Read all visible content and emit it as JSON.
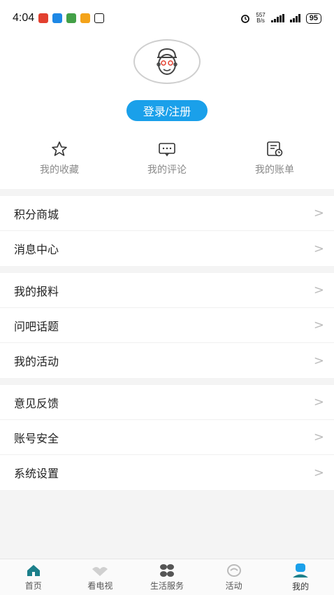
{
  "status_bar": {
    "time": "4:04",
    "net_speed_value": "557",
    "net_speed_unit": "B/s",
    "battery": "95"
  },
  "profile": {
    "login_label": "登录/注册"
  },
  "quick_actions": [
    {
      "label": "我的收藏",
      "icon": "star-icon"
    },
    {
      "label": "我的评论",
      "icon": "comment-icon"
    },
    {
      "label": "我的账单",
      "icon": "bill-icon"
    }
  ],
  "menu_groups": [
    {
      "items": [
        {
          "label": "积分商城"
        },
        {
          "label": "消息中心"
        }
      ]
    },
    {
      "items": [
        {
          "label": "我的报料"
        },
        {
          "label": "问吧话题"
        },
        {
          "label": "我的活动"
        }
      ]
    },
    {
      "items": [
        {
          "label": "意见反馈"
        },
        {
          "label": "账号安全"
        },
        {
          "label": "系统设置"
        }
      ]
    }
  ],
  "chevron": ">",
  "tabs": [
    {
      "label": "首页",
      "icon": "home-icon"
    },
    {
      "label": "看电视",
      "icon": "tv-icon"
    },
    {
      "label": "生活服务",
      "icon": "services-icon"
    },
    {
      "label": "活动",
      "icon": "activity-icon"
    },
    {
      "label": "我的",
      "icon": "profile-icon"
    }
  ],
  "colors": {
    "accent": "#1aa0ea",
    "tab_active": "#1b7f8a"
  }
}
